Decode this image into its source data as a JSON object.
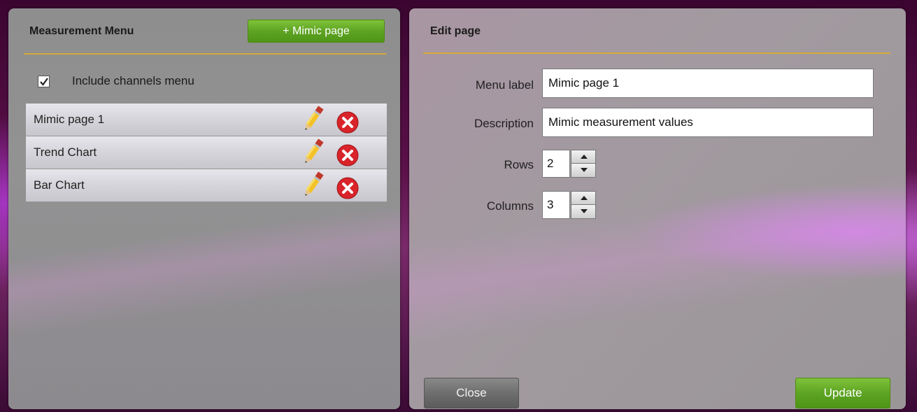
{
  "left_panel": {
    "title": "Measurement Menu",
    "add_button_label": "+ Mimic page",
    "include_channels": {
      "label": "Include channels menu",
      "checked": true
    },
    "items": [
      {
        "label": "Mimic page 1",
        "edit_icon": "pencil-icon",
        "delete_icon": "delete-icon"
      },
      {
        "label": "Trend Chart",
        "edit_icon": "pencil-icon",
        "delete_icon": "delete-icon"
      },
      {
        "label": "Bar Chart",
        "edit_icon": "pencil-icon",
        "delete_icon": "delete-icon"
      }
    ]
  },
  "right_panel": {
    "title": "Edit page",
    "fields": {
      "menu_label": {
        "label": "Menu label",
        "value": "Mimic page 1"
      },
      "description": {
        "label": "Description",
        "value": "Mimic measurement values"
      },
      "rows": {
        "label": "Rows",
        "value": "2"
      },
      "columns": {
        "label": "Columns",
        "value": "3"
      }
    },
    "close_button_label": "Close",
    "update_button_label": "Update"
  },
  "colors": {
    "accent_green": "#5ea423",
    "divider_gold": "#d7a93a",
    "delete_red": "#d9232a"
  }
}
